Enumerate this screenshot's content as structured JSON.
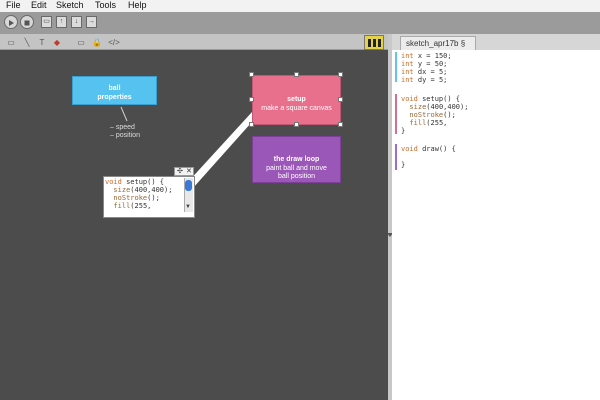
{
  "menu": {
    "file": "File",
    "edit": "Edit",
    "sketch": "Sketch",
    "tools": "Tools",
    "help": "Help"
  },
  "toolbar": {
    "tools": [
      "▭",
      "╲",
      "T",
      "◆",
      "▭",
      "🔒",
      "</>"
    ]
  },
  "editor": {
    "tab_label": "sketch_apr17b §",
    "lines": {
      "l1a": "int",
      "l1b": " x = 150;",
      "l2a": "int",
      "l2b": " y = 50;",
      "l3a": "int",
      "l3b": " dx = 5;",
      "l4a": "int",
      "l4b": " dy = 5;",
      "l5a": "void",
      "l5b": " setup() {",
      "l6a": "  size",
      "l6b": "(400,400);",
      "l7a": "  noStroke",
      "l7b": "();",
      "l8a": "  fill",
      "l8b": "(255,",
      "l9": "}",
      "l10a": "void",
      "l10b": " draw() {",
      "l11": "}"
    },
    "bar_colors": {
      "vars": "#5fc8e0",
      "setup": "#d36f90",
      "draw": "#a36dbf"
    }
  },
  "canvas": {
    "nodes": {
      "ball": {
        "title": "ball",
        "subtitle": "properties",
        "color": "#55c2ef"
      },
      "setup": {
        "title": "setup",
        "subtitle": "make a square canvas",
        "color": "#e8708c"
      },
      "draw": {
        "title": "the draw loop",
        "line2": "paint ball and move",
        "line3": "ball position",
        "color": "#9b57b8"
      }
    },
    "notes": {
      "speed": "– speed",
      "position": "– position"
    },
    "popup": {
      "l1a": "void",
      "l1b": " setup() {",
      "l2a": "  size",
      "l2b": "(400,400);",
      "l3a": "  noStroke",
      "l3b": "();",
      "l4a": "  fill",
      "l4b": "(255,",
      "move_icon": "✣",
      "close_icon": "✕"
    }
  }
}
